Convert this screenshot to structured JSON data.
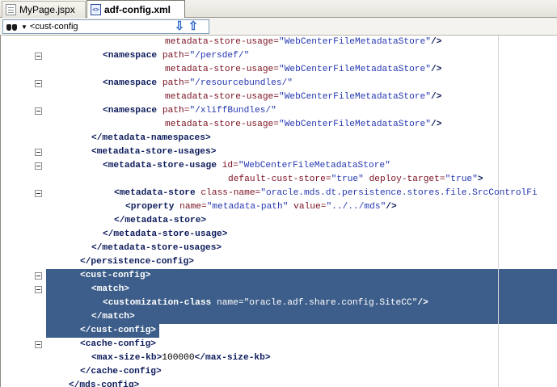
{
  "tabs": [
    {
      "label": "MyPage.jspx",
      "icon": "jspx-file-icon",
      "active": false
    },
    {
      "label": "adf-config.xml",
      "icon": "xml-file-icon",
      "active": true
    }
  ],
  "navbar": {
    "breadcrumb": "<cust-config",
    "icon": "binoculars-icon",
    "down_icon": "arrow-down-icon",
    "up_icon": "arrow-up-icon"
  },
  "colors": {
    "selection": "#3d5e8a",
    "tag": "#0d1c5c",
    "attribute": "#7a1020",
    "value": "#2437b0"
  },
  "code_lines": [
    {
      "fold": false,
      "hl": false,
      "tokens": [
        {
          "c": "attr",
          "t": "metadata-store-usage="
        },
        {
          "c": "val",
          "t": "\"WebCenterFileMetadataStore\""
        },
        {
          "c": "tag",
          "t": "/>"
        }
      ]
    },
    {
      "fold": true,
      "hl": false,
      "tokens": [
        {
          "c": "tag",
          "t": "<namespace "
        },
        {
          "c": "attr",
          "t": "path="
        },
        {
          "c": "val",
          "t": "\"/persdef/\""
        }
      ]
    },
    {
      "fold": false,
      "hl": false,
      "tokens": [
        {
          "c": "attr",
          "t": "metadata-store-usage="
        },
        {
          "c": "val",
          "t": "\"WebCenterFileMetadataStore\""
        },
        {
          "c": "tag",
          "t": "/>"
        }
      ]
    },
    {
      "fold": true,
      "hl": false,
      "tokens": [
        {
          "c": "tag",
          "t": "<namespace "
        },
        {
          "c": "attr",
          "t": "path="
        },
        {
          "c": "val",
          "t": "\"/resourcebundles/\""
        }
      ]
    },
    {
      "fold": false,
      "hl": false,
      "tokens": [
        {
          "c": "attr",
          "t": "metadata-store-usage="
        },
        {
          "c": "val",
          "t": "\"WebCenterFileMetadataStore\""
        },
        {
          "c": "tag",
          "t": "/>"
        }
      ]
    },
    {
      "fold": true,
      "hl": false,
      "tokens": [
        {
          "c": "tag",
          "t": "<namespace "
        },
        {
          "c": "attr",
          "t": "path="
        },
        {
          "c": "val",
          "t": "\"/xliffBundles/\""
        }
      ]
    },
    {
      "fold": false,
      "hl": false,
      "tokens": [
        {
          "c": "attr",
          "t": "metadata-store-usage="
        },
        {
          "c": "val",
          "t": "\"WebCenterFileMetadataStore\""
        },
        {
          "c": "tag",
          "t": "/>"
        }
      ]
    },
    {
      "fold": false,
      "hl": false,
      "tokens": [
        {
          "c": "tag",
          "t": "</metadata-namespaces>"
        }
      ]
    },
    {
      "fold": true,
      "hl": false,
      "tokens": [
        {
          "c": "tag",
          "t": "<metadata-store-usages>"
        }
      ]
    },
    {
      "fold": true,
      "hl": false,
      "tokens": [
        {
          "c": "tag",
          "t": "<metadata-store-usage "
        },
        {
          "c": "attr",
          "t": "id="
        },
        {
          "c": "val",
          "t": "\"WebCenterFileMetadataStore\""
        }
      ]
    },
    {
      "fold": false,
      "hl": false,
      "tokens": [
        {
          "c": "attr",
          "t": "default-cust-store="
        },
        {
          "c": "val",
          "t": "\"true\" "
        },
        {
          "c": "attr",
          "t": "deploy-target="
        },
        {
          "c": "val",
          "t": "\"true\""
        },
        {
          "c": "tag",
          "t": ">"
        }
      ]
    },
    {
      "fold": true,
      "hl": false,
      "tokens": [
        {
          "c": "tag",
          "t": "<metadata-store "
        },
        {
          "c": "attr",
          "t": "class-name="
        },
        {
          "c": "val",
          "t": "\"oracle.mds.dt.persistence.stores.file.SrcControlFi"
        }
      ]
    },
    {
      "fold": false,
      "hl": false,
      "tokens": [
        {
          "c": "tag",
          "t": "<property "
        },
        {
          "c": "attr",
          "t": "name="
        },
        {
          "c": "val",
          "t": "\"metadata-path\" "
        },
        {
          "c": "attr",
          "t": "value="
        },
        {
          "c": "val",
          "t": "\"../../mds\""
        },
        {
          "c": "tag",
          "t": "/>"
        }
      ]
    },
    {
      "fold": false,
      "hl": false,
      "tokens": [
        {
          "c": "tag",
          "t": "</metadata-store>"
        }
      ]
    },
    {
      "fold": false,
      "hl": false,
      "tokens": [
        {
          "c": "tag",
          "t": "</metadata-store-usage>"
        }
      ]
    },
    {
      "fold": false,
      "hl": false,
      "tokens": [
        {
          "c": "tag",
          "t": "</metadata-store-usages>"
        }
      ]
    },
    {
      "fold": false,
      "hl": false,
      "tokens": [
        {
          "c": "tag",
          "t": "</persistence-config>"
        }
      ]
    },
    {
      "fold": true,
      "hl": true,
      "tokens": [
        {
          "c": "tag",
          "t": "<cust-config>"
        }
      ]
    },
    {
      "fold": true,
      "hl": true,
      "tokens": [
        {
          "c": "tag",
          "t": "<match>"
        }
      ]
    },
    {
      "fold": false,
      "hl": true,
      "tokens": [
        {
          "c": "tag",
          "t": "<customization-class "
        },
        {
          "c": "attr",
          "t": "name="
        },
        {
          "c": "val",
          "t": "\"oracle.adf.share.config.SiteCC\""
        },
        {
          "c": "tag",
          "t": "/>"
        }
      ]
    },
    {
      "fold": false,
      "hl": true,
      "tokens": [
        {
          "c": "tag",
          "t": "</match>"
        }
      ]
    },
    {
      "fold": false,
      "hl": true,
      "tokens": [
        {
          "c": "tag",
          "t": "</cust-config>"
        }
      ]
    },
    {
      "fold": true,
      "hl": false,
      "tokens": [
        {
          "c": "tag",
          "t": "<cache-config>"
        }
      ]
    },
    {
      "fold": false,
      "hl": false,
      "tokens": [
        {
          "c": "tag",
          "t": "<max-size-kb>"
        },
        {
          "c": "txt",
          "t": "100000"
        },
        {
          "c": "tag",
          "t": "</max-size-kb>"
        }
      ]
    },
    {
      "fold": false,
      "hl": false,
      "tokens": [
        {
          "c": "tag",
          "t": "</cache-config>"
        }
      ]
    },
    {
      "fold": false,
      "hl": false,
      "tokens": [
        {
          "c": "tag",
          "t": "</mds-config>"
        }
      ]
    }
  ]
}
